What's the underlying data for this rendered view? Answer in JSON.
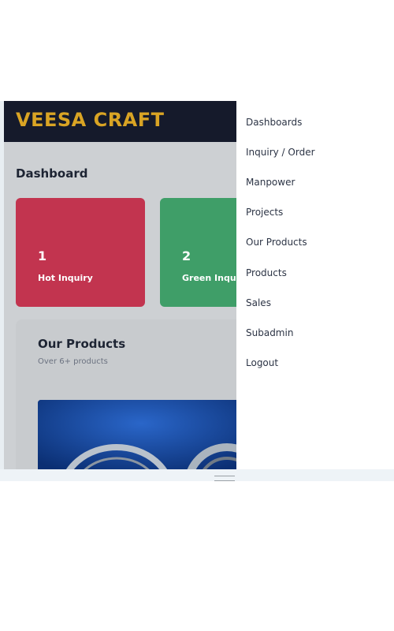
{
  "app": {
    "brand": "VEESA CRAFT",
    "page_title": "Dashboard",
    "cards": [
      {
        "value": "1",
        "label": "Hot Inquiry",
        "color": "#c2344f"
      },
      {
        "value": "2",
        "label": "Green Inqu",
        "color": "#3f9e68"
      }
    ],
    "products": {
      "title": "Our Products",
      "subtitle": "Over 6+ products"
    }
  },
  "menu": {
    "items": [
      {
        "label": "Dashboards"
      },
      {
        "label": "Inquiry / Order"
      },
      {
        "label": "Manpower"
      },
      {
        "label": "Projects"
      },
      {
        "label": "Our Products"
      },
      {
        "label": "Products"
      },
      {
        "label": "Sales"
      },
      {
        "label": "Subadmin"
      },
      {
        "label": "Logout"
      }
    ]
  },
  "colors": {
    "brand": "#d9a424",
    "topbar": "#151a2b"
  }
}
